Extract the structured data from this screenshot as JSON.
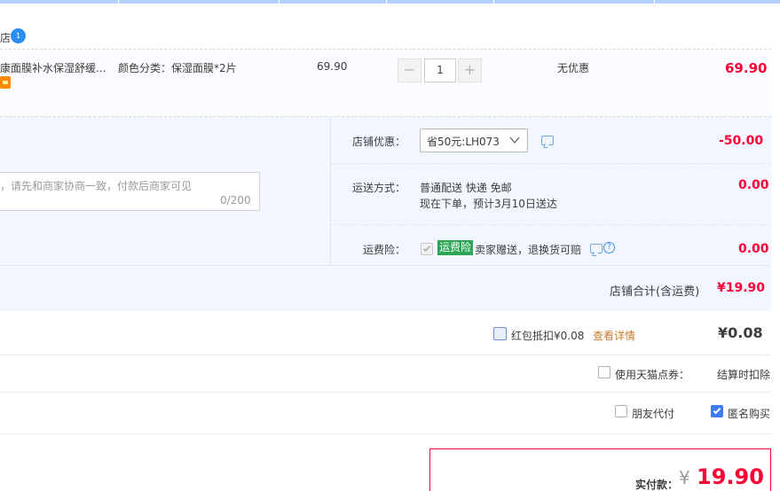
{
  "shop": {
    "name_fragment": "店",
    "badge": "1"
  },
  "item": {
    "title": "康面膜补水保湿舒缓...",
    "sku": "颜色分类：保湿面膜*2片",
    "price": "69.90",
    "quantity": "1",
    "qty_minus": "−",
    "qty_plus": "+",
    "discount": "无优惠",
    "subtotal": "69.90"
  },
  "message": {
    "placeholder": "，请先和商家协商一致，付款后商家可见",
    "counter": "0/200"
  },
  "shop_discount": {
    "label": "店铺优惠：",
    "selected": "省50元:LH073",
    "amount": "-50.00"
  },
  "shipping": {
    "label": "运送方式：",
    "method": "普通配送 快递 免邮",
    "eta": "现在下单，预计3月10日送达",
    "amount": "0.00"
  },
  "insurance": {
    "label": "运费险：",
    "badge": "运费险",
    "desc": "卖家赠送，退换货可赔",
    "help": "?",
    "amount": "0.00"
  },
  "shop_total": {
    "label": "店铺合计(含运费)",
    "amount": "¥19.90"
  },
  "red_packet": {
    "label": "红包抵扣¥0.08",
    "details_link": "查看详情",
    "amount": "¥0.08"
  },
  "tmall_points": {
    "label": "使用天猫点券：",
    "note": "结算时扣除"
  },
  "options": {
    "friend_pay": "朋友代付",
    "anonymous": "匿名购买"
  },
  "payment": {
    "label": "实付款：",
    "currency": "¥",
    "amount": "19.90"
  },
  "colors": {
    "accent_red": "#ff0036",
    "link_orange": "#c47a2c",
    "brand_blue": "#3d7ff0",
    "insurance_green": "#2aa655"
  }
}
